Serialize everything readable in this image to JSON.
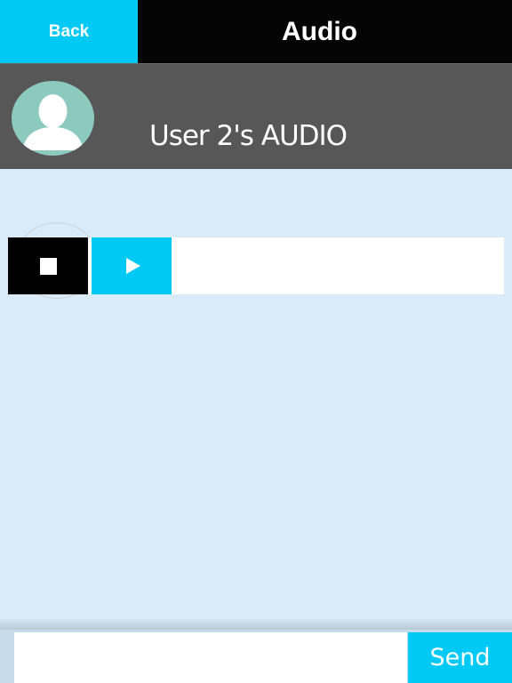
{
  "nav": {
    "back_label": "Back",
    "title": "Audio"
  },
  "user": {
    "title": "User 2's AUDIO",
    "avatar_icon": "user-silhouette-icon"
  },
  "player": {
    "stop_icon": "stop-icon",
    "play_icon": "play-icon"
  },
  "composer": {
    "input_value": "",
    "send_label": "Send"
  },
  "colors": {
    "accent": "#01c9f6",
    "nav_bg": "#040404",
    "header_bg": "#575757",
    "page_bg": "#d9ebf8",
    "avatar_bg": "#8cc9bf"
  }
}
